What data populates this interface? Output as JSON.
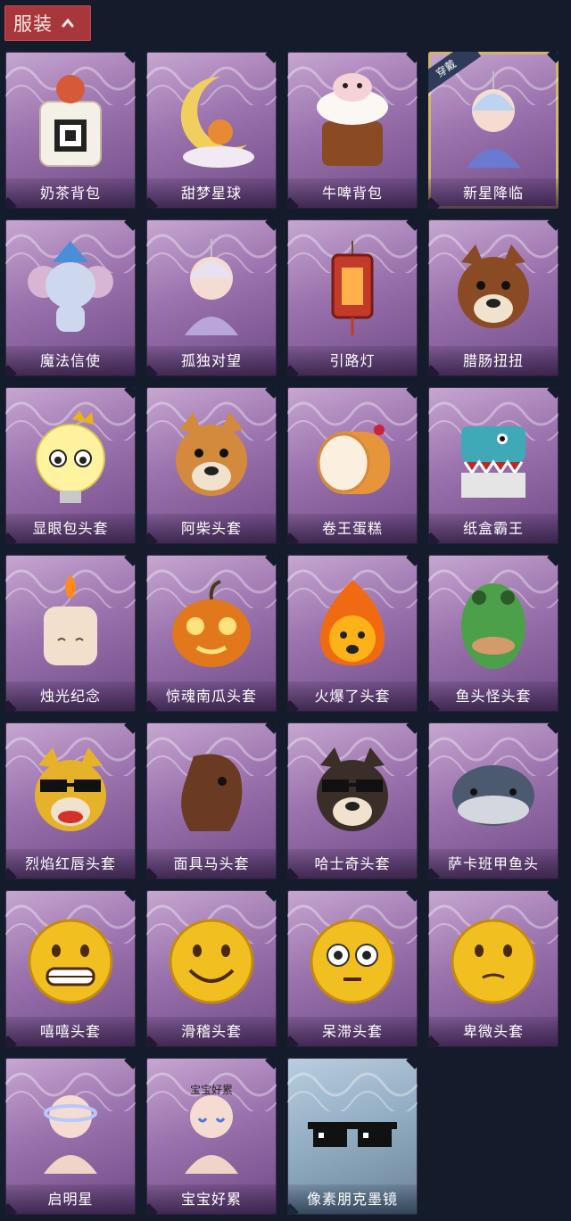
{
  "header": {
    "title": "服装",
    "toggle_icon": "chevron-up-icon"
  },
  "items": [
    {
      "name": "奶茶背包",
      "icon": "milk-tea-backpack-icon",
      "frame": "purple"
    },
    {
      "name": "甜梦星球",
      "icon": "sweet-dream-moon-icon",
      "frame": "purple"
    },
    {
      "name": "牛啤背包",
      "icon": "cow-beer-backpack-icon",
      "frame": "purple"
    },
    {
      "name": "新星降临",
      "icon": "new-star-pendant-icon",
      "frame": "purple",
      "badge": "穿戴"
    },
    {
      "name": "魔法信使",
      "icon": "magic-elephant-icon",
      "frame": "purple"
    },
    {
      "name": "孤独对望",
      "icon": "lonely-gaze-pendant-icon",
      "frame": "purple"
    },
    {
      "name": "引路灯",
      "icon": "lantern-icon",
      "frame": "purple"
    },
    {
      "name": "腊肠扭扭",
      "icon": "sausage-dog-icon",
      "frame": "purple"
    },
    {
      "name": "显眼包头套",
      "icon": "bulb-head-icon",
      "frame": "purple"
    },
    {
      "name": "阿柴头套",
      "icon": "shiba-head-icon",
      "frame": "purple"
    },
    {
      "name": "卷王蛋糕",
      "icon": "roll-cake-icon",
      "frame": "purple"
    },
    {
      "name": "纸盒霸王",
      "icon": "box-dino-icon",
      "frame": "purple"
    },
    {
      "name": "烛光纪念",
      "icon": "candle-head-icon",
      "frame": "purple"
    },
    {
      "name": "惊魂南瓜头套",
      "icon": "pumpkin-head-icon",
      "frame": "purple"
    },
    {
      "name": "火爆了头套",
      "icon": "fire-head-icon",
      "frame": "purple"
    },
    {
      "name": "鱼头怪头套",
      "icon": "fish-head-icon",
      "frame": "purple"
    },
    {
      "name": "烈焰红唇头套",
      "icon": "pika-lips-head-icon",
      "frame": "purple"
    },
    {
      "name": "面具马头套",
      "icon": "horse-head-icon",
      "frame": "purple"
    },
    {
      "name": "哈士奇头套",
      "icon": "husky-head-icon",
      "frame": "purple"
    },
    {
      "name": "萨卡班甲鱼头",
      "icon": "sacabambaspis-head-icon",
      "frame": "purple"
    },
    {
      "name": "嘻嘻头套",
      "icon": "grin-emoji-head-icon",
      "frame": "purple"
    },
    {
      "name": "滑稽头套",
      "icon": "funny-emoji-head-icon",
      "frame": "purple"
    },
    {
      "name": "呆滞头套",
      "icon": "dazed-emoji-head-icon",
      "frame": "purple"
    },
    {
      "name": "卑微头套",
      "icon": "humble-emoji-head-icon",
      "frame": "purple"
    },
    {
      "name": "启明星",
      "icon": "morning-star-icon",
      "frame": "purple"
    },
    {
      "name": "宝宝好累",
      "icon": "tired-baby-icon",
      "frame": "purple",
      "art_text": "宝宝好累"
    },
    {
      "name": "像素朋克墨镜",
      "icon": "pixel-sunglasses-icon",
      "frame": "frost"
    }
  ],
  "colors": {
    "background": "#141b2b",
    "header_tab": "#a8373b",
    "card_purple": "#9a72ad",
    "card_frost": "#90aac0",
    "worn_border": "#d6b36a"
  }
}
